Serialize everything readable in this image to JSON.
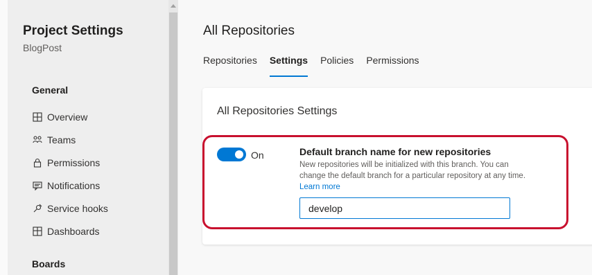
{
  "sidebar": {
    "title": "Project Settings",
    "project": "BlogPost",
    "general_heading": "General",
    "items": [
      {
        "label": "Overview",
        "icon": "overview-icon"
      },
      {
        "label": "Teams",
        "icon": "teams-icon"
      },
      {
        "label": "Permissions",
        "icon": "lock-icon"
      },
      {
        "label": "Notifications",
        "icon": "notifications-icon"
      },
      {
        "label": "Service hooks",
        "icon": "service-hooks-icon"
      },
      {
        "label": "Dashboards",
        "icon": "dashboards-icon"
      }
    ],
    "boards_heading": "Boards"
  },
  "main": {
    "title": "All Repositories",
    "tabs": [
      {
        "label": "Repositories",
        "active": false
      },
      {
        "label": "Settings",
        "active": true
      },
      {
        "label": "Policies",
        "active": false
      },
      {
        "label": "Permissions",
        "active": false
      }
    ],
    "card": {
      "title": "All Repositories Settings",
      "toggle": {
        "state": "On"
      },
      "setting_name": "Default branch name for new repositories",
      "setting_desc": "New repositories will be initialized with this branch. You can change the default branch for a particular repository at any time.",
      "learn_more": "Learn more",
      "branch_value": "develop"
    }
  },
  "colors": {
    "accent": "#0078d4",
    "highlight": "#c8102e"
  }
}
